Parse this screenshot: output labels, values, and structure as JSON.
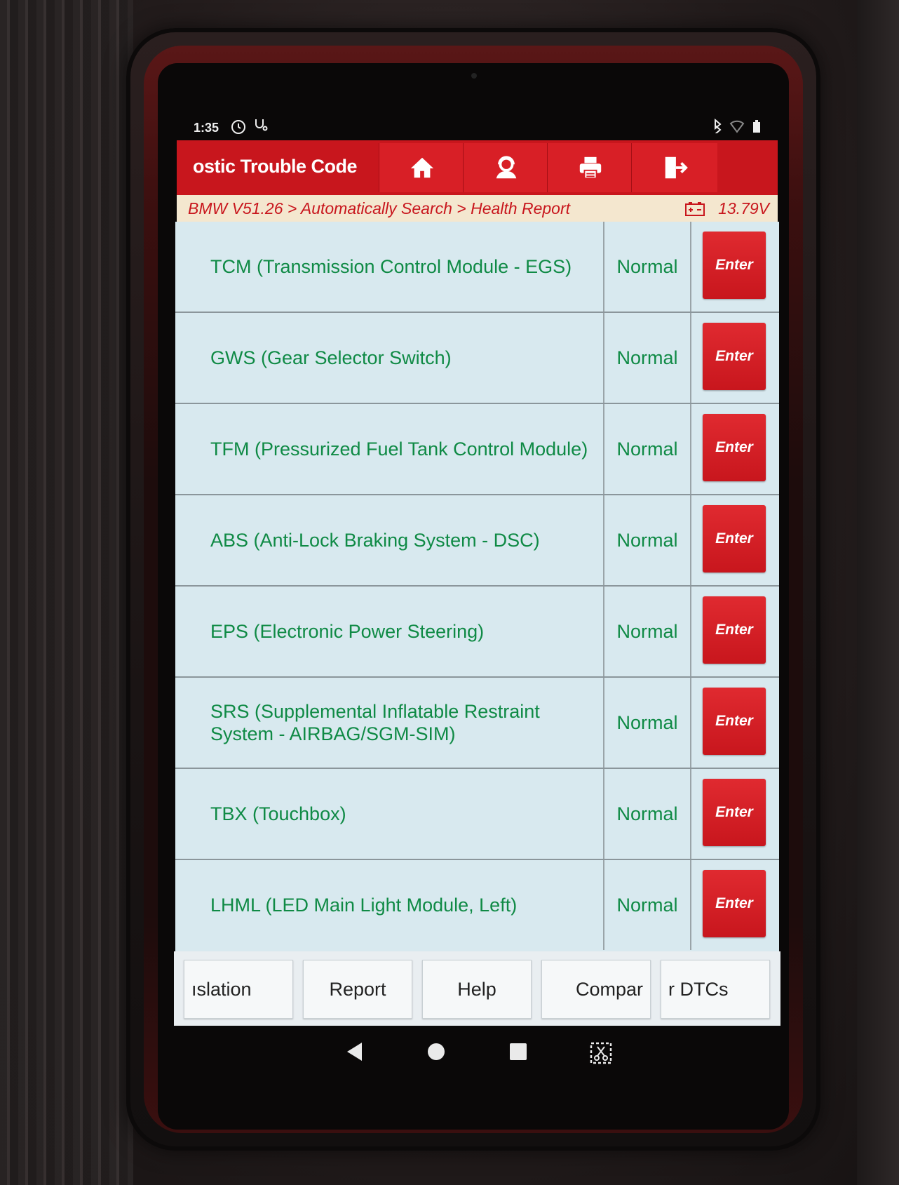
{
  "status_bar": {
    "time": "1:35",
    "left_icons": [
      "timer-icon",
      "stethoscope-icon"
    ],
    "right_icons": [
      "bluetooth-icon",
      "wifi-icon",
      "battery-icon"
    ]
  },
  "header": {
    "title": "ostic Trouble Code",
    "buttons": [
      "home-icon",
      "support-icon",
      "print-icon",
      "exit-icon"
    ],
    "color": "#c8161d"
  },
  "breadcrumb": {
    "path": "BMW V51.26 > Automatically Search > Health Report",
    "voltage": "13.79V"
  },
  "modules": [
    {
      "name": "TCM (Transmission Control Module - EGS)",
      "status": "Normal",
      "action": "Enter"
    },
    {
      "name": "GWS (Gear Selector Switch)",
      "status": "Normal",
      "action": "Enter"
    },
    {
      "name": "TFM (Pressurized Fuel Tank Control Module)",
      "status": "Normal",
      "action": "Enter"
    },
    {
      "name": "ABS (Anti-Lock Braking System - DSC)",
      "status": "Normal",
      "action": "Enter"
    },
    {
      "name": "EPS (Electronic Power Steering)",
      "status": "Normal",
      "action": "Enter"
    },
    {
      "name": "SRS (Supplemental Inflatable Restraint System - AIRBAG/SGM-SIM)",
      "status": "Normal",
      "action": "Enter"
    },
    {
      "name": "TBX (Touchbox)",
      "status": "Normal",
      "action": "Enter"
    },
    {
      "name": "LHML (LED Main Light Module, Left)",
      "status": "Normal",
      "action": "Enter"
    }
  ],
  "bottom_buttons": {
    "translation": "ıslation",
    "report": "Report",
    "help": "Help",
    "compare": "Compar",
    "clear_dtcs": "r DTCs"
  },
  "colors": {
    "accent": "#c8161d",
    "text_green": "#0f8a45",
    "row_bg": "#d8e9ef"
  }
}
